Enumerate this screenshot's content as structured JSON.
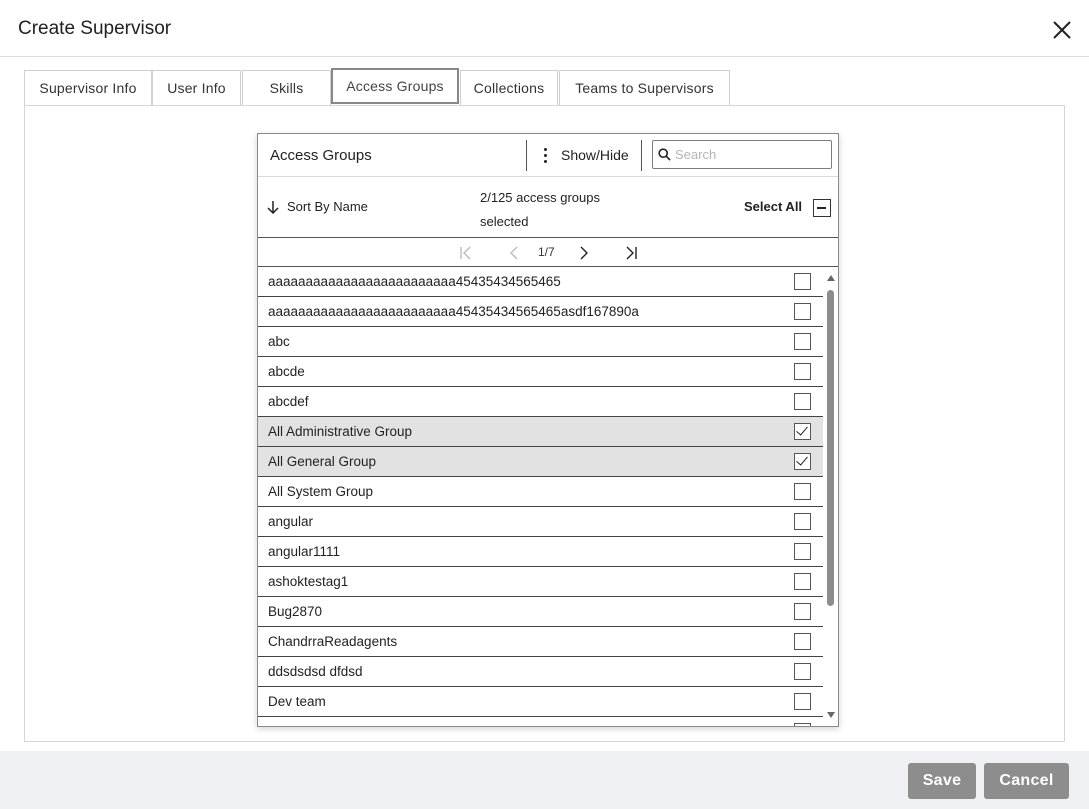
{
  "dialog": {
    "title": "Create Supervisor"
  },
  "tabs": [
    {
      "label": "Supervisor Info",
      "active": false
    },
    {
      "label": "User Info",
      "active": false
    },
    {
      "label": "Skills",
      "active": false
    },
    {
      "label": "Access Groups",
      "active": true
    },
    {
      "label": "Collections",
      "active": false
    },
    {
      "label": "Teams to Supervisors",
      "active": false
    }
  ],
  "picker": {
    "title": "Access Groups",
    "show_hide_label": "Show/Hide",
    "search_placeholder": "Search",
    "sort_label": "Sort By Name",
    "selection_count_line1": "2/125 access groups",
    "selection_count_line2": "selected",
    "select_all_label": "Select All",
    "pagination": {
      "text": "1/7",
      "current_page": 1,
      "total_pages": 7
    },
    "items": [
      {
        "name": "aaaaaaaaaaaaaaaaaaaaaaaaa45435434565465",
        "checked": false
      },
      {
        "name": "aaaaaaaaaaaaaaaaaaaaaaaaa45435434565465asdf167890a",
        "checked": false
      },
      {
        "name": "abc",
        "checked": false
      },
      {
        "name": "abcde",
        "checked": false
      },
      {
        "name": "abcdef",
        "checked": false
      },
      {
        "name": "All Administrative Group",
        "checked": true
      },
      {
        "name": "All General Group",
        "checked": true
      },
      {
        "name": "All System Group",
        "checked": false
      },
      {
        "name": "angular",
        "checked": false
      },
      {
        "name": "angular1111",
        "checked": false
      },
      {
        "name": "ashoktestag1",
        "checked": false
      },
      {
        "name": "Bug2870",
        "checked": false
      },
      {
        "name": "ChandrraReadagents",
        "checked": false
      },
      {
        "name": "ddsdsdsd dfdsd",
        "checked": false
      },
      {
        "name": "Dev team",
        "checked": false
      }
    ]
  },
  "footer": {
    "save_label": "Save",
    "cancel_label": "Cancel"
  }
}
